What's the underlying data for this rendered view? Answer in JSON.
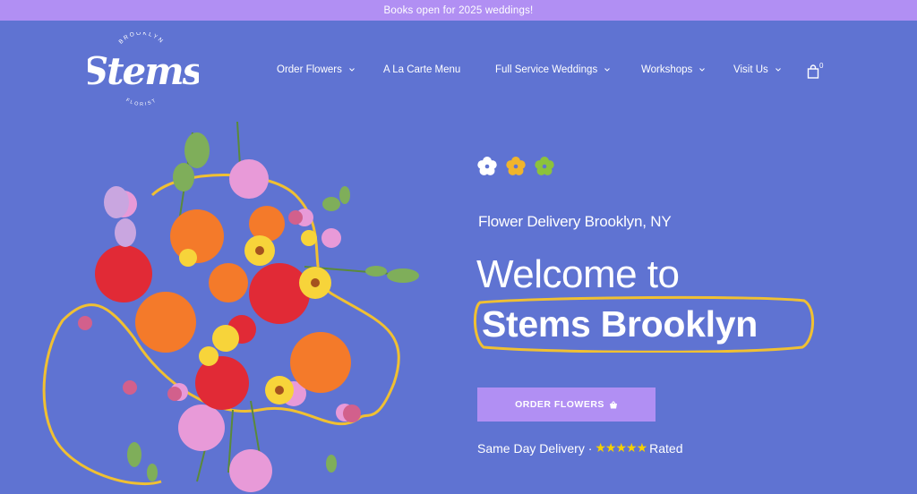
{
  "announcement": {
    "text": "Books open for 2025 weddings!"
  },
  "logo": {
    "word": "Stems",
    "top_arc": "BROOKLYN",
    "bottom_arc": "FLORIST"
  },
  "nav": {
    "items": [
      {
        "label": "Order Flowers",
        "has_dropdown": true
      },
      {
        "label": "A La Carte Menu",
        "has_dropdown": false
      },
      {
        "label": "Full Service Weddings",
        "has_dropdown": true
      },
      {
        "label": "Workshops",
        "has_dropdown": true
      },
      {
        "label": "Visit Us",
        "has_dropdown": true
      }
    ],
    "cart_count": "0"
  },
  "hero": {
    "subheading": "Flower Delivery Brooklyn, NY",
    "welcome": "Welcome to",
    "brand": "Stems Brooklyn",
    "cta_label": "ORDER FLOWERS",
    "rated_prefix": "Same Day Delivery ·",
    "stars": "★★★★★",
    "rated_suffix": "Rated"
  },
  "colors": {
    "background": "#5f73d2",
    "accent_purple": "#b18ff3",
    "accent_yellow": "#f0c032",
    "flower_white": "#ffffff",
    "flower_yellow": "#f0b42c",
    "flower_green": "#8cc23c"
  },
  "icons": {
    "nav_dropdown": "chevron-down-icon",
    "cart": "shopping-bag-icon",
    "cta": "basket-icon"
  }
}
